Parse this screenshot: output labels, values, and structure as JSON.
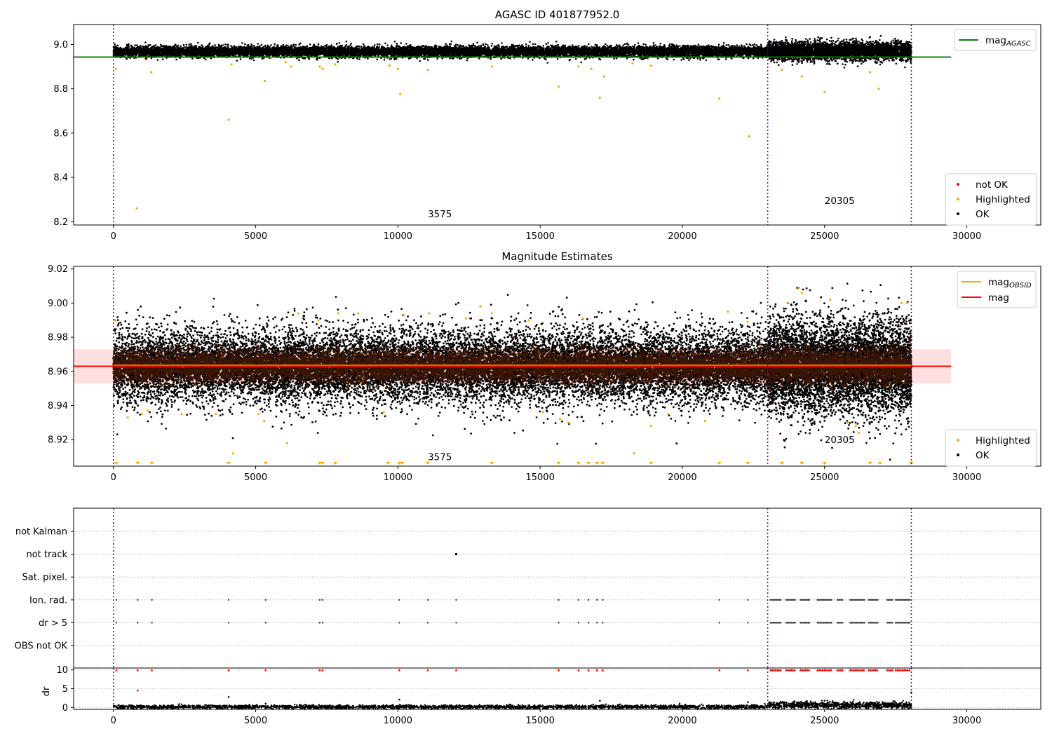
{
  "chart_data": [
    {
      "id": "agasc",
      "type": "scatter",
      "title": "AGASC ID 401877952.0",
      "xlim": [
        -1400,
        32600
      ],
      "ylim": [
        8.185,
        9.09
      ],
      "xticks": [
        0,
        5000,
        10000,
        15000,
        20000,
        25000,
        30000
      ],
      "yticks": [
        8.2,
        8.4,
        8.6,
        8.8,
        9.0
      ],
      "ytick_labels": [
        "8.2",
        "8.4",
        "8.6",
        "8.8",
        "9.0"
      ],
      "vlines": [
        0,
        23000,
        28050
      ],
      "annotations": [
        {
          "text": "3575",
          "x": 11050,
          "y": 8.22
        },
        {
          "text": "20305",
          "x": 25000,
          "y": 8.28
        }
      ],
      "reference_lines": [
        {
          "name": "mag",
          "subscript": "AGASC",
          "y": 8.943,
          "color": "#008000",
          "x_range": [
            -1400,
            29450
          ]
        }
      ],
      "ok_band": {
        "segments": [
          {
            "x_range": [
              0,
              23000
            ],
            "center": 8.968,
            "spread": 0.012
          },
          {
            "x_range": [
              23000,
              28050
            ],
            "center": 8.97,
            "spread": 0.02
          }
        ]
      },
      "highlighted_points": [
        [
          80,
          8.89
        ],
        [
          820,
          8.26
        ],
        [
          1080,
          8.94
        ],
        [
          1330,
          8.875
        ],
        [
          4050,
          8.66
        ],
        [
          4150,
          8.91
        ],
        [
          5320,
          8.835
        ],
        [
          5550,
          8.94
        ],
        [
          6050,
          8.92
        ],
        [
          6250,
          8.9
        ],
        [
          7250,
          8.9
        ],
        [
          7350,
          8.89
        ],
        [
          7800,
          8.91
        ],
        [
          9700,
          8.905
        ],
        [
          10000,
          8.89
        ],
        [
          10080,
          8.775
        ],
        [
          11050,
          8.885
        ],
        [
          13300,
          8.9
        ],
        [
          15650,
          8.81
        ],
        [
          16350,
          8.9
        ],
        [
          16800,
          8.89
        ],
        [
          17100,
          8.76
        ],
        [
          17250,
          8.855
        ],
        [
          18250,
          8.915
        ],
        [
          18900,
          8.905
        ],
        [
          21300,
          8.755
        ],
        [
          22350,
          8.585
        ],
        [
          23500,
          8.885
        ],
        [
          24200,
          8.855
        ],
        [
          25000,
          8.785
        ],
        [
          26600,
          8.875
        ],
        [
          26900,
          8.8
        ]
      ],
      "legend": {
        "placement": "lower-right",
        "entries": [
          {
            "label": "not OK",
            "color": "#ff0000"
          },
          {
            "label": "Highlighted",
            "color": "#ffa500"
          },
          {
            "label": "OK",
            "color": "#000000"
          }
        ]
      },
      "line_legend": {
        "placement": "upper-right",
        "entries": [
          {
            "label": "mag",
            "subscript": "AGASC",
            "color": "#008000"
          }
        ]
      }
    },
    {
      "id": "estimates",
      "type": "scatter",
      "title": "Magnitude Estimates",
      "xlim": [
        -1400,
        32600
      ],
      "ylim": [
        8.9045,
        9.0215
      ],
      "xticks": [
        0,
        5000,
        10000,
        15000,
        20000,
        25000,
        30000
      ],
      "yticks": [
        8.92,
        8.94,
        8.96,
        8.98,
        9.0,
        9.02
      ],
      "ytick_labels": [
        "8.92",
        "8.94",
        "8.96",
        "8.98",
        "9.00",
        "9.02"
      ],
      "vlines": [
        0,
        23000,
        28050
      ],
      "annotations": [
        {
          "text": "3575",
          "x": 11050,
          "y": 8.908
        },
        {
          "text": "20305",
          "x": 25000,
          "y": 8.918
        }
      ],
      "reference_lines": [
        {
          "name": "mag",
          "subscript": "OBSID",
          "y": 8.9635,
          "color": "#ffa500",
          "x_range": [
            0,
            28050
          ]
        },
        {
          "name": "mag",
          "y": 8.963,
          "color": "#ff0000",
          "x_range": [
            -1400,
            29450
          ]
        }
      ],
      "error_band": {
        "y_range": [
          8.953,
          8.973
        ],
        "x_range": [
          -1400,
          29450
        ],
        "color": "#ffc0c0"
      },
      "ok_band": {
        "segments": [
          {
            "x_range": [
              0,
              23000
            ],
            "center": 8.963,
            "spread": 0.011
          },
          {
            "x_range": [
              23000,
              28050
            ],
            "center": 8.963,
            "spread": 0.014
          }
        ]
      },
      "highlighted_points": [
        [
          50,
          8.99
        ],
        [
          500,
          8.933
        ],
        [
          1000,
          8.935
        ],
        [
          1200,
          8.937
        ],
        [
          2400,
          8.935
        ],
        [
          3600,
          8.935
        ],
        [
          4200,
          8.912
        ],
        [
          5100,
          8.935
        ],
        [
          5300,
          8.931
        ],
        [
          6100,
          8.918
        ],
        [
          6500,
          8.994
        ],
        [
          7200,
          8.99
        ],
        [
          7900,
          8.994
        ],
        [
          8600,
          8.994
        ],
        [
          9500,
          8.936
        ],
        [
          10200,
          8.993
        ],
        [
          11100,
          8.994
        ],
        [
          12400,
          8.991
        ],
        [
          12900,
          8.998
        ],
        [
          13300,
          8.994
        ],
        [
          14600,
          8.99
        ],
        [
          15100,
          8.936
        ],
        [
          15700,
          8.932
        ],
        [
          16000,
          8.93
        ],
        [
          16500,
          8.991
        ],
        [
          18300,
          8.912
        ],
        [
          18900,
          8.928
        ],
        [
          19500,
          8.935
        ],
        [
          20800,
          8.931
        ],
        [
          21600,
          8.995
        ],
        [
          22300,
          8.989
        ],
        [
          23700,
          9.0
        ],
        [
          24100,
          9.009
        ],
        [
          24200,
          9.006
        ],
        [
          25200,
          9.002
        ],
        [
          25800,
          8.93
        ],
        [
          26100,
          8.928
        ],
        [
          26200,
          8.924
        ],
        [
          27700,
          9.0
        ],
        [
          27900,
          9.0
        ]
      ],
      "lower_markers_x": [
        100,
        850,
        1350,
        4050,
        5350,
        7250,
        7350,
        7800,
        9650,
        10050,
        10150,
        11050,
        13300,
        15650,
        16350,
        16700,
        17000,
        17200,
        18900,
        21300,
        22300,
        23500,
        24200,
        25000,
        26600,
        26950,
        28050
      ],
      "legend": {
        "placement": "lower-right",
        "entries": [
          {
            "label": "Highlighted",
            "color": "#ffa500"
          },
          {
            "label": "OK",
            "color": "#000000"
          }
        ]
      },
      "line_legend": {
        "placement": "upper-right",
        "entries": [
          {
            "label": "mag",
            "subscript": "OBSID",
            "color": "#ffa500"
          },
          {
            "label": "mag",
            "color": "#ff0000"
          }
        ]
      }
    },
    {
      "id": "flags",
      "type": "scatter",
      "xlim": [
        -1400,
        32600
      ],
      "categories": [
        "not Kalman",
        "not track",
        "Sat. pixel.",
        "Ion. rad.",
        "dr > 5",
        "OBS not OK"
      ],
      "vlines": [
        0,
        23000,
        28050
      ],
      "not_track_x": [
        12050
      ],
      "flag_x": [
        100,
        850,
        1350,
        4050,
        5350,
        7250,
        7350,
        10050,
        11050,
        12050,
        15650,
        16350,
        16700,
        17000,
        17200,
        21300,
        22300
      ],
      "dense_segments": [
        [
          23100,
          23500
        ],
        [
          23650,
          24000
        ],
        [
          24150,
          24500
        ],
        [
          24750,
          25250
        ],
        [
          25450,
          25650
        ],
        [
          25900,
          26400
        ],
        [
          26550,
          26900
        ],
        [
          27200,
          27400
        ],
        [
          27500,
          28000
        ]
      ]
    },
    {
      "id": "dr",
      "type": "scatter",
      "ylabel": "dr",
      "xlim": [
        -1400,
        32600
      ],
      "ylim": [
        -0.5,
        10.5
      ],
      "xticks": [
        0,
        5000,
        10000,
        15000,
        20000,
        25000,
        30000
      ],
      "yticks": [
        0,
        5,
        10
      ],
      "ytick_labels": [
        "0",
        "5",
        "10"
      ],
      "vlines": [
        0,
        23000,
        28050
      ],
      "outliers": [
        [
          850,
          4.5
        ],
        [
          4050,
          2.8
        ],
        [
          10050,
          2.1
        ],
        [
          5350,
          1.0
        ],
        [
          17100,
          1.8
        ],
        [
          22300,
          1.4
        ],
        [
          25000,
          1.8
        ],
        [
          28050,
          4.0
        ]
      ],
      "baseline": {
        "segments": [
          {
            "x_range": [
              0,
              23000
            ],
            "center": 0.15,
            "spread": 0.25
          },
          {
            "x_range": [
              23000,
              28050
            ],
            "center": 0.6,
            "spread": 0.45
          }
        ]
      }
    }
  ]
}
